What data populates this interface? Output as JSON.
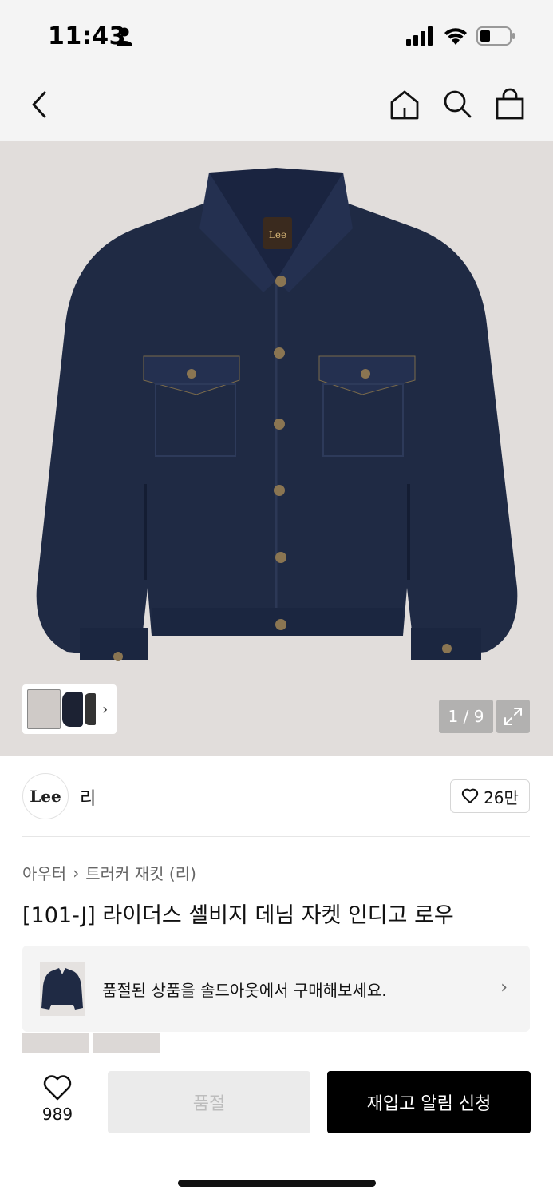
{
  "status_bar": {
    "time": "11:43"
  },
  "product": {
    "page_counter": "1 / 9",
    "brand_logo_text": "Lee",
    "jacket_label_text": "Lee",
    "brand_name": "리",
    "brand_likes": "26만",
    "breadcrumb": [
      "아우터",
      "트러커 재킷 (리)"
    ],
    "breadcrumb_separator": "›",
    "title": "[101-J] 라이더스 셀비지 데님 자켓 인디고 로우"
  },
  "soldout_banner": {
    "text": "품절된 상품을 솔드아웃에서 구매해보세요.",
    "chevron": "›"
  },
  "bottom_bar": {
    "favorite_count": "989",
    "soldout_label": "품절",
    "restock_label": "재입고 알림 신청"
  },
  "thumbnail_chevron": "›",
  "colors": {
    "image_bg": "#e1dddb",
    "denim": "#1f2a44",
    "primary_button": "#000000",
    "disabled_button": "#ebebeb"
  }
}
